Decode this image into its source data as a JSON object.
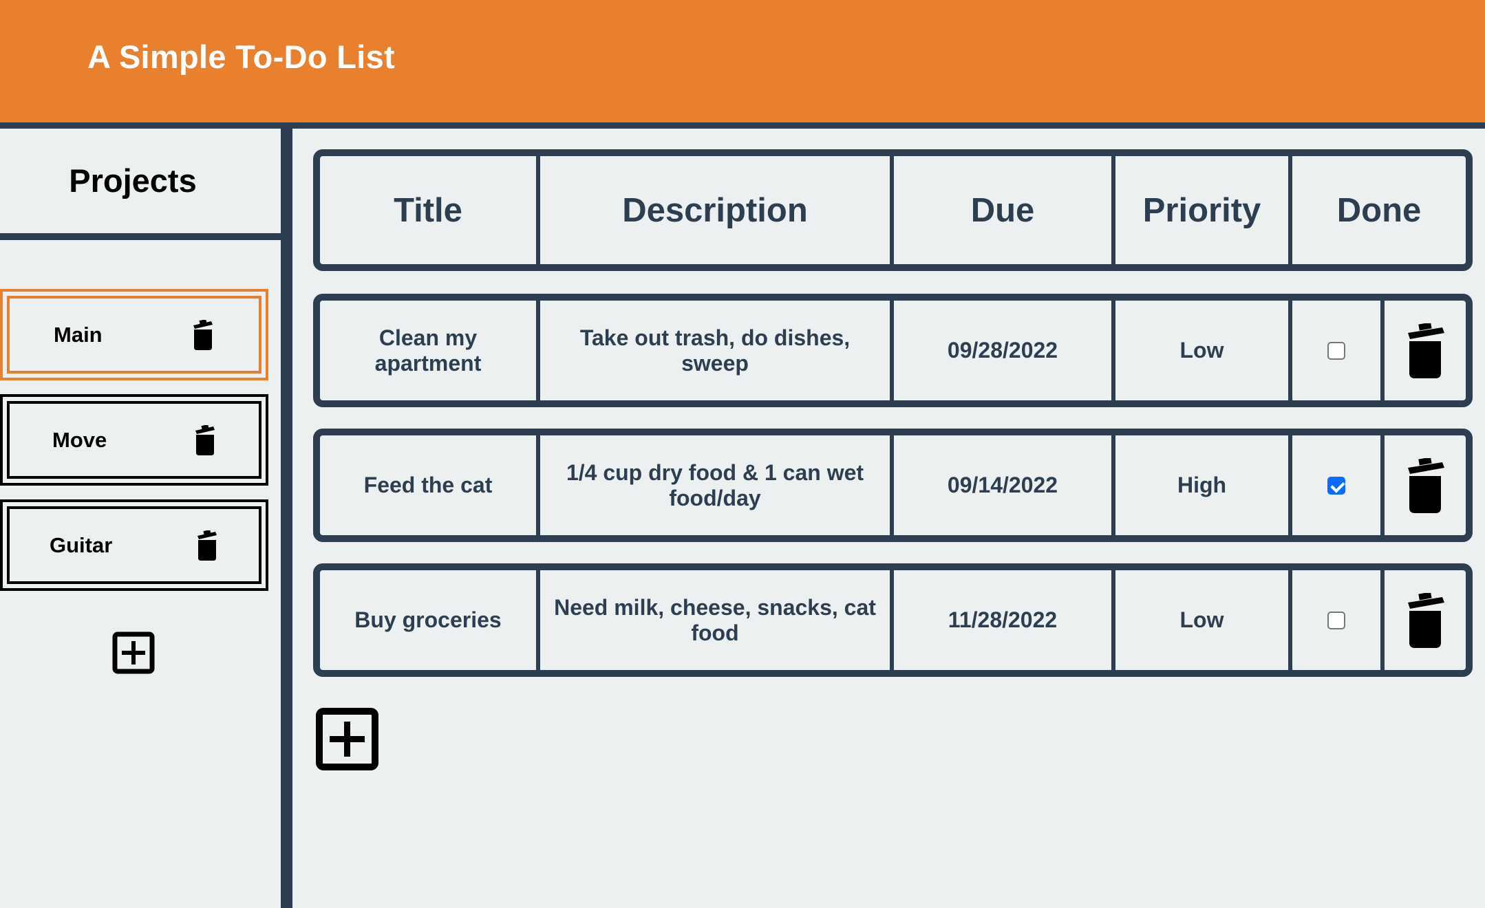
{
  "app": {
    "title": "A Simple To-Do List"
  },
  "colors": {
    "accent": "#e8802e",
    "border": "#2c3e50",
    "background": "#ecf0f1",
    "check": "#0a6cff"
  },
  "sidebar": {
    "heading": "Projects",
    "projects": [
      {
        "label": "Main",
        "active": true,
        "icon": "trash-icon"
      },
      {
        "label": "Move",
        "active": false,
        "icon": "trash-icon"
      },
      {
        "label": "Guitar",
        "active": false,
        "icon": "trash-icon"
      }
    ],
    "add_icon": "plus-square-icon"
  },
  "table": {
    "headers": [
      "Title",
      "Description",
      "Due",
      "Priority",
      "Done"
    ],
    "rows": [
      {
        "title": "Clean my apartment",
        "description": "Take out trash, do dishes, sweep",
        "due": "09/28/2022",
        "priority": "Low",
        "done": false
      },
      {
        "title": "Feed the cat",
        "description": "1/4 cup dry food & 1 can wet food/day",
        "due": "09/14/2022",
        "priority": "High",
        "done": true
      },
      {
        "title": "Buy groceries",
        "description": "Need milk, cheese, snacks, cat food",
        "due": "11/28/2022",
        "priority": "Low",
        "done": false
      }
    ],
    "add_icon": "plus-square-icon"
  }
}
